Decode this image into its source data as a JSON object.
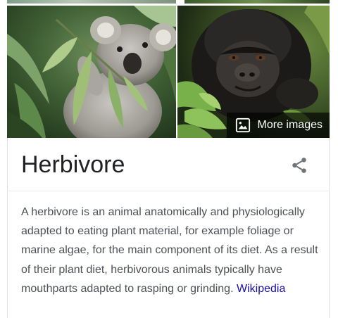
{
  "images": {
    "koala_alt": "Koala eating leaves",
    "gorilla_alt": "Young gorilla among leaves",
    "more_images_label": "More images",
    "more_images_icon": "image-icon"
  },
  "panel": {
    "title": "Herbivore",
    "share_icon": "share-icon"
  },
  "description": {
    "text": "A herbivore is an animal anatomically and physiologically adapted to eating plant material, for example foliage or marine algae, for the main component of its diet. As a result of their plant diet, herbivorous animals typically have mouthparts adapted to rasping or grinding.",
    "source_link": "Wikipedia"
  },
  "colors": {
    "title": "#202124",
    "body_text": "#4d5156",
    "link": "#1a0dab",
    "divider": "#ebebeb",
    "icon": "#70757a"
  }
}
